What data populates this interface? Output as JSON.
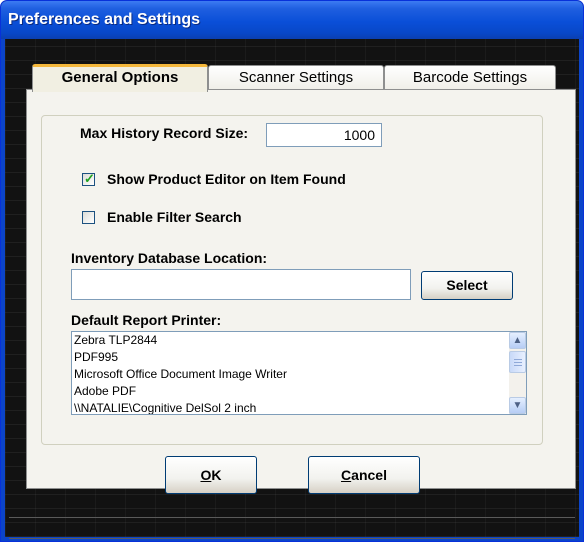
{
  "window": {
    "title": "Preferences and Settings"
  },
  "tabs": [
    {
      "label": "General Options",
      "active": true
    },
    {
      "label": "Scanner Settings",
      "active": false
    },
    {
      "label": "Barcode Settings",
      "active": false
    }
  ],
  "general": {
    "max_history_label": "Max History Record Size:",
    "max_history_value": "1000",
    "show_editor_label": "Show Product Editor on Item Found",
    "show_editor_checked": true,
    "filter_search_label": "Enable Filter Search",
    "filter_search_checked": false,
    "db_location_label": "Inventory Database Location:",
    "db_location_value": "",
    "select_label": "Select",
    "printer_label": "Default Report Printer:",
    "printers": [
      "Zebra  TLP2844",
      "PDF995",
      "Microsoft Office Document Image Writer",
      "Adobe PDF",
      "\\\\NATALIE\\Cognitive DelSol 2 inch"
    ]
  },
  "buttons": {
    "ok_mnemonic": "O",
    "ok_rest": "K",
    "cancel_mnemonic": "C",
    "cancel_rest": "ancel"
  },
  "icons": {
    "scroll_up": "chevron-up-icon",
    "scroll_down": "chevron-down-icon",
    "check": "checkmark-icon"
  },
  "colors": {
    "titlebar": "#0a4fd8",
    "panel": "#f4f3ee",
    "active_tab_accent": "#f5b83c",
    "checkmark": "#21a121"
  }
}
